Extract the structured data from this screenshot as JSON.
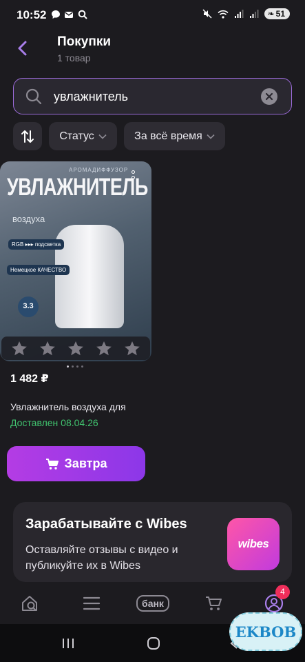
{
  "status_bar": {
    "time": "10:52",
    "battery": "51"
  },
  "header": {
    "title": "Покупки",
    "subtitle": "1 товар"
  },
  "search": {
    "value": "увлажнитель",
    "placeholder": ""
  },
  "filters": {
    "status_label": "Статус",
    "period_label": "За всё время"
  },
  "product": {
    "image_texts": {
      "top": "АРОМАДИФФУЗОР",
      "title": "УВЛАЖНИТЕЛЬ",
      "subtitle": "воздуха",
      "badge_rgb": "RGB ▸▸▸ подсветка",
      "badge_quality": "Немецкое КАЧЕСТВО",
      "volume": "3.3"
    },
    "rating_stars": 0,
    "price": "1 482 ₽",
    "name": "Увлажнитель воздуха для",
    "delivery": "Доставлен 08.04.26",
    "buy_label": "Завтра"
  },
  "promo": {
    "title": "Зарабатывайте с Wibes",
    "text": "Оставляйте отзывы с видео и публикуйте их в Wibes",
    "logo": "wibes"
  },
  "bottom_nav": {
    "bank_label": "банк",
    "profile_badge": "4"
  },
  "watermark": "EKBOB",
  "colors": {
    "accent": "#9b6bd9",
    "buy_gradient_start": "#b43ce4",
    "delivered": "#41c46f",
    "badge": "#ef2e5b"
  }
}
